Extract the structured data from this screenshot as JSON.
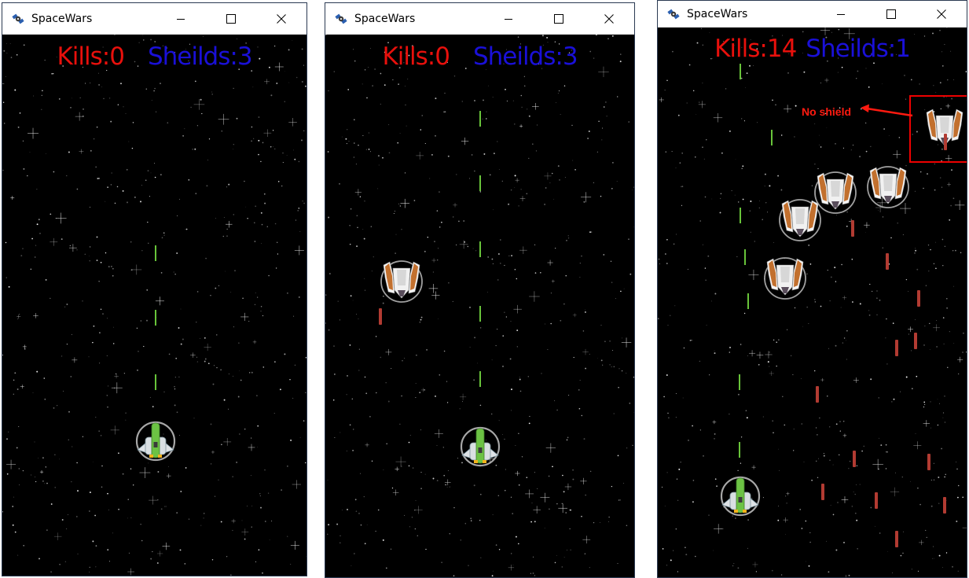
{
  "windows": [
    {
      "title": "SpaceWars",
      "hud": {
        "kills_label": "Kills:0",
        "shields_label": "Sheilds:3"
      },
      "player_shielded": true,
      "enemies": [],
      "annotation": null
    },
    {
      "title": "SpaceWars",
      "hud": {
        "kills_label": "Kills:0",
        "shields_label": "Sheilds:3"
      },
      "player_shielded": true,
      "enemies": [
        {
          "shielded": true
        }
      ],
      "annotation": null
    },
    {
      "title": "SpaceWars",
      "hud": {
        "kills_label": "Kills:14",
        "shields_label": "Sheilds:1"
      },
      "player_shielded": true,
      "enemies": [
        {
          "shielded": true
        },
        {
          "shielded": true
        },
        {
          "shielded": true
        },
        {
          "shielded": true
        },
        {
          "shielded": false
        }
      ],
      "annotation": {
        "text": "No shield"
      }
    }
  ],
  "colors": {
    "kills": "#e8100c",
    "shields": "#1a10d8",
    "player_laser": "#68c43a",
    "enemy_laser": "#b23b32",
    "annotation": "#e00000"
  },
  "icons": {
    "app": "spacewars-app-icon",
    "minimize": "minimize-icon",
    "maximize": "maximize-icon",
    "close": "close-icon"
  }
}
